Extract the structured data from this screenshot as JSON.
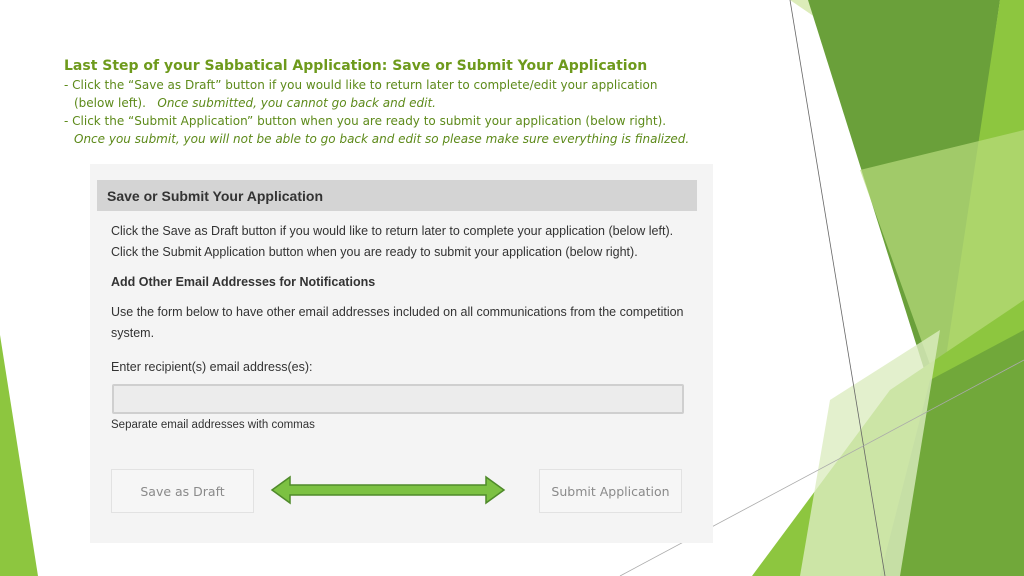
{
  "slide": {
    "title": "Last Step of your Sabbatical Application:  Save or Submit Your Application",
    "bullet1": "- Click the “Save as Draft” button if you would like to return later to complete/edit your application",
    "bullet1_cont": "(below left).",
    "bullet1_note": "Once submitted, you cannot go back and edit.",
    "bullet2": "- Click the “Submit Application” button when you are ready to submit your application (below right).",
    "bullet2_note": "Once you submit, you will not be able to go back and edit so please make sure everything is finalized."
  },
  "screenshot": {
    "header": "Save or Submit Your Application",
    "line1": "Click the Save as Draft button if you would like to return later to complete your application (below left).",
    "line2": "Click the Submit Application button when you are ready to submit your application (below right).",
    "section_title": "Add Other Email Addresses for Notifications",
    "desc1": "Use the form below to have other email addresses included on all communications from the competition",
    "desc2": "system.",
    "email_label": "Enter recipient(s) email address(es):",
    "email_value": "",
    "email_hint": "Separate email addresses with commas",
    "save_label": "Save as Draft",
    "submit_label": "Submit Application"
  },
  "colors": {
    "accent": "#6e9a1c",
    "arrow_fill": "#7cc142",
    "arrow_stroke": "#4f8a2a"
  }
}
